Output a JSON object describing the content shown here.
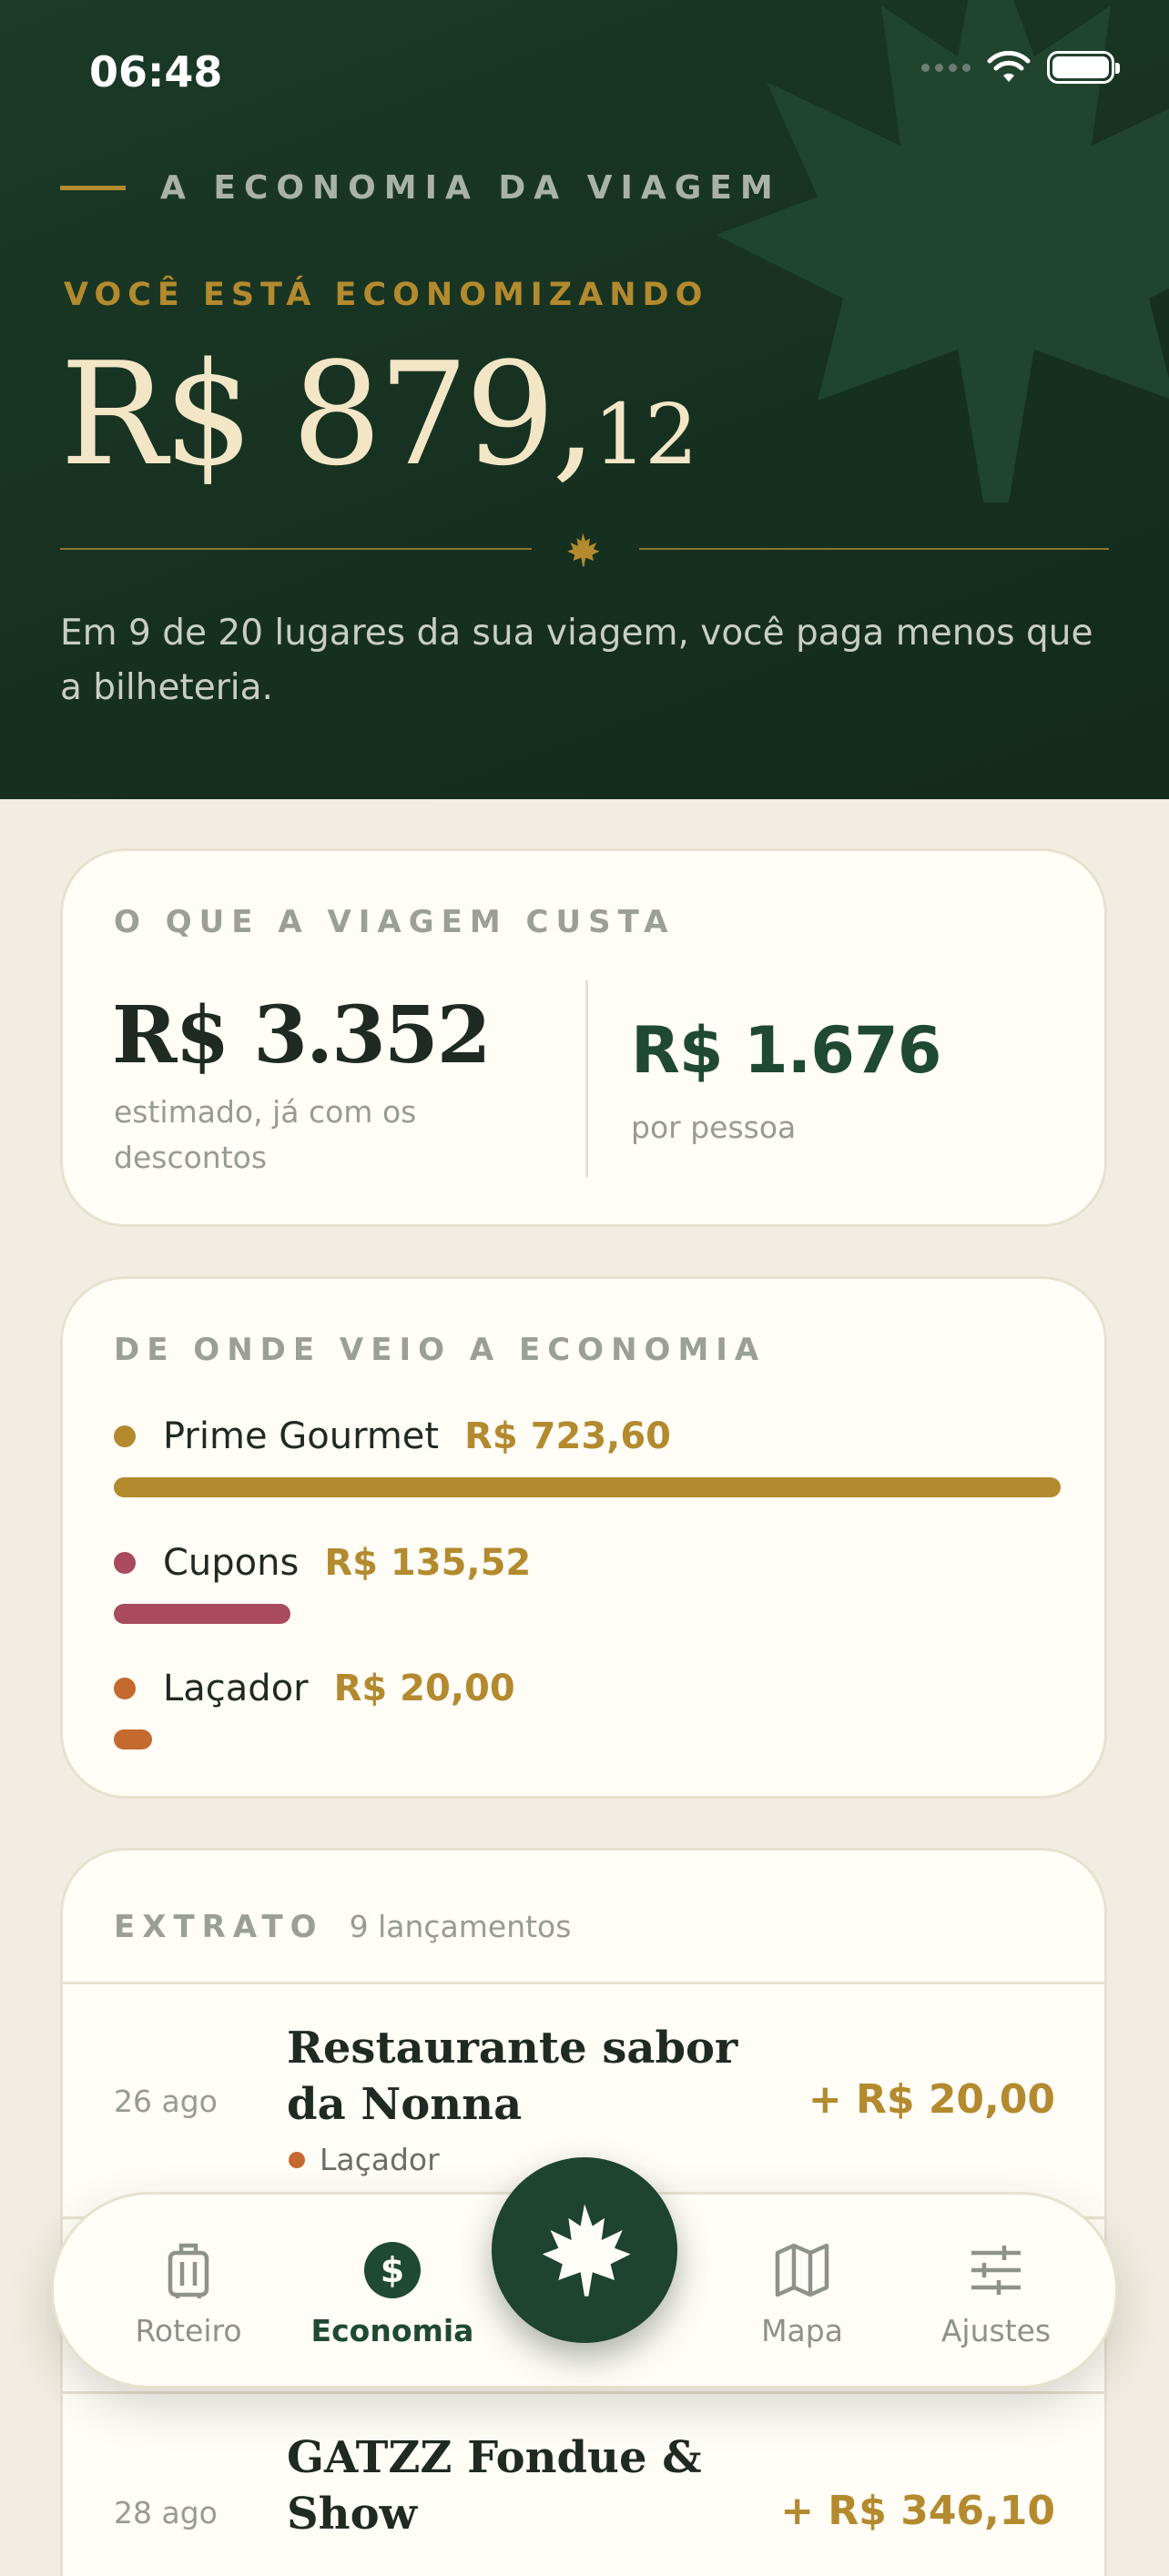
{
  "status": {
    "time": "06:48"
  },
  "hero": {
    "eyebrow": "A ECONOMIA DA VIAGEM",
    "saving_label": "VOCÊ ESTÁ ECONOMIZANDO",
    "amount_main": "R$ 879,",
    "amount_cents": "12",
    "description": "Em 9 de 20 lugares da sua viagem, você paga menos que a bilheteria."
  },
  "cost": {
    "title": "O QUE A VIAGEM CUSTA",
    "total": "R$ 3.352",
    "total_note": "estimado, já com os descontos",
    "per_person": "R$ 1.676",
    "per_person_note": "por pessoa"
  },
  "sources": {
    "title": "DE ONDE VEIO A ECONOMIA",
    "items": [
      {
        "name": "Prime Gourmet",
        "value": "R$ 723,60",
        "share": 1.0,
        "color": "#B38A2E"
      },
      {
        "name": "Cupons",
        "value": "R$ 135,52",
        "share": 0.187,
        "color": "#A94A5E"
      },
      {
        "name": "Laçador",
        "value": "R$ 20,00",
        "share": 0.04,
        "color": "#C46A2F"
      }
    ]
  },
  "statement": {
    "title": "EXTRATO",
    "count": "9 lançamentos",
    "entries": [
      {
        "date": "26 ago",
        "title": "Restaurante sabor da Nonna",
        "source": "Laçador",
        "source_color": "#C46A2F",
        "amount": "+ R$ 20,00"
      },
      {
        "date": "28 ago",
        "title": "GATZZ Fondue & Show",
        "amount": "+ R$ 346,10"
      }
    ]
  },
  "tabbar": {
    "tabs": [
      {
        "label": "Roteiro",
        "icon": "suitcase-icon",
        "active": false
      },
      {
        "label": "Economia",
        "icon": "dollar-circle-icon",
        "active": true
      },
      {
        "label": "Mapa",
        "icon": "map-icon",
        "active": false
      },
      {
        "label": "Ajustes",
        "icon": "sliders-icon",
        "active": false
      }
    ],
    "center_icon": "maple-leaf-icon"
  },
  "colors": {
    "hero_bg": "#1B3A27",
    "gold": "#B38A2E",
    "cream": "#F2E6C6",
    "page_bg": "#F2EDE2",
    "card_bg": "#FFFDF6",
    "brand_green": "#1F4A31"
  }
}
